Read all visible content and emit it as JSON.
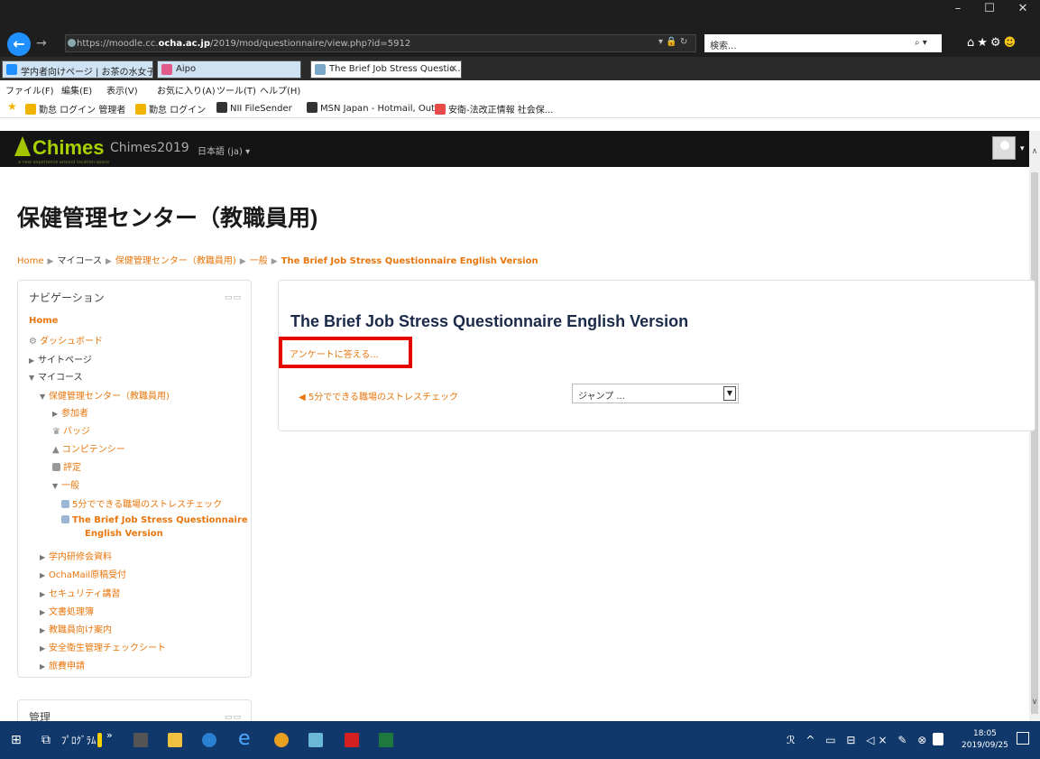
{
  "browser": {
    "url_prefix": "https://moodle.cc.",
    "url_domain": "ocha.ac.jp",
    "url_path": "/2019/mod/questionnaire/view.php?id=5912",
    "url_tools": "▾ 🔒 ↻",
    "search_placeholder": "検索...",
    "search_icon": "⌕ ▾",
    "window_controls": [
      "–",
      "☐",
      "✕"
    ],
    "toolbar_icons": "⌂★⚙",
    "tabs": [
      {
        "label": "学内者向けページ | お茶の水女子...",
        "icon_color": "#1e90ff"
      },
      {
        "label": "Aipo",
        "icon_color": "#e05a8a"
      },
      {
        "label": "The Brief Job Stress Questio...",
        "icon_color": "#7aa7c7",
        "active": true
      }
    ],
    "tab_close": "✕",
    "menu": [
      "ファイル(F)",
      "編集(E)",
      "表示(V)",
      "お気に入り(A)",
      "ツール(T)",
      "ヘルプ(H)"
    ],
    "favorites": [
      {
        "label": "勤怠 ログイン 管理者",
        "icon_color": "#f0b400"
      },
      {
        "label": "勤怠 ログイン",
        "icon_color": "#f0b400"
      },
      {
        "label": "NII FileSender",
        "icon_color": "#333333"
      },
      {
        "label": "MSN Japan - Hotmail, Out...",
        "icon_color": "#333333"
      },
      {
        "label": "安衛-法改正情報 社会保...",
        "icon_color": "#e84a4a"
      }
    ],
    "fav_star": "★"
  },
  "moodle": {
    "logo": "Chimes",
    "logo_tagline": "a new experience around location space",
    "site_name": "Chimes2019",
    "language": "日本語 (ja) ▾",
    "avatar_caret": "▾"
  },
  "page": {
    "title": "保健管理センター（教職員用)",
    "breadcrumb": [
      "Home",
      "マイコース",
      "保健管理センター（教職員用)",
      "一般",
      "The Brief Job Stress Questionnaire English Version"
    ],
    "breadcrumb_sep": "▶"
  },
  "navigation": {
    "title": "ナビゲーション",
    "controls": "▭▭",
    "items": [
      {
        "label": "Home"
      },
      {
        "label": "ダッシュボード"
      },
      {
        "label": "サイトページ"
      },
      {
        "label": "マイコース"
      },
      {
        "label": "保健管理センター（教職員用)"
      },
      {
        "label": "参加者"
      },
      {
        "label": "バッジ"
      },
      {
        "label": "コンピテンシー"
      },
      {
        "label": "評定"
      },
      {
        "label": "一般"
      },
      {
        "label": "5分でできる職場のストレスチェック"
      },
      {
        "label": "The Brief Job Stress Questionnaire"
      },
      {
        "label": "English Version"
      },
      {
        "label": "学内研修会資料"
      },
      {
        "label": "OchaMail原稿受付"
      },
      {
        "label": "セキュリティ講習"
      },
      {
        "label": "文書処理簿"
      },
      {
        "label": "教職員向け案内"
      },
      {
        "label": "安全衛生管理チェックシート"
      },
      {
        "label": "旅費申請"
      }
    ]
  },
  "admin": {
    "title": "管理",
    "controls": "▭▭"
  },
  "activity": {
    "title": "The Brief Job Stress Questionnaire English Version",
    "answer_link": "アンケートに答える...",
    "prev_link": "◀ 5分でできる職場のストレスチェック",
    "jump_label": "ジャンプ ...",
    "jump_arrow": "▼"
  },
  "taskbar": {
    "programs_label": "ﾌﾟﾛｸﾞﾗﾑ",
    "chevron": "»",
    "time": "18:05",
    "date": "2019/09/25",
    "tray_icons": "ℛ ^ ▭ ⊟ ◁× ✎ ⊗"
  },
  "colors": {
    "link": "#e8760d",
    "highlight_box": "#e60000",
    "taskbar": "#10386a",
    "moodle_nav": "#141414"
  }
}
